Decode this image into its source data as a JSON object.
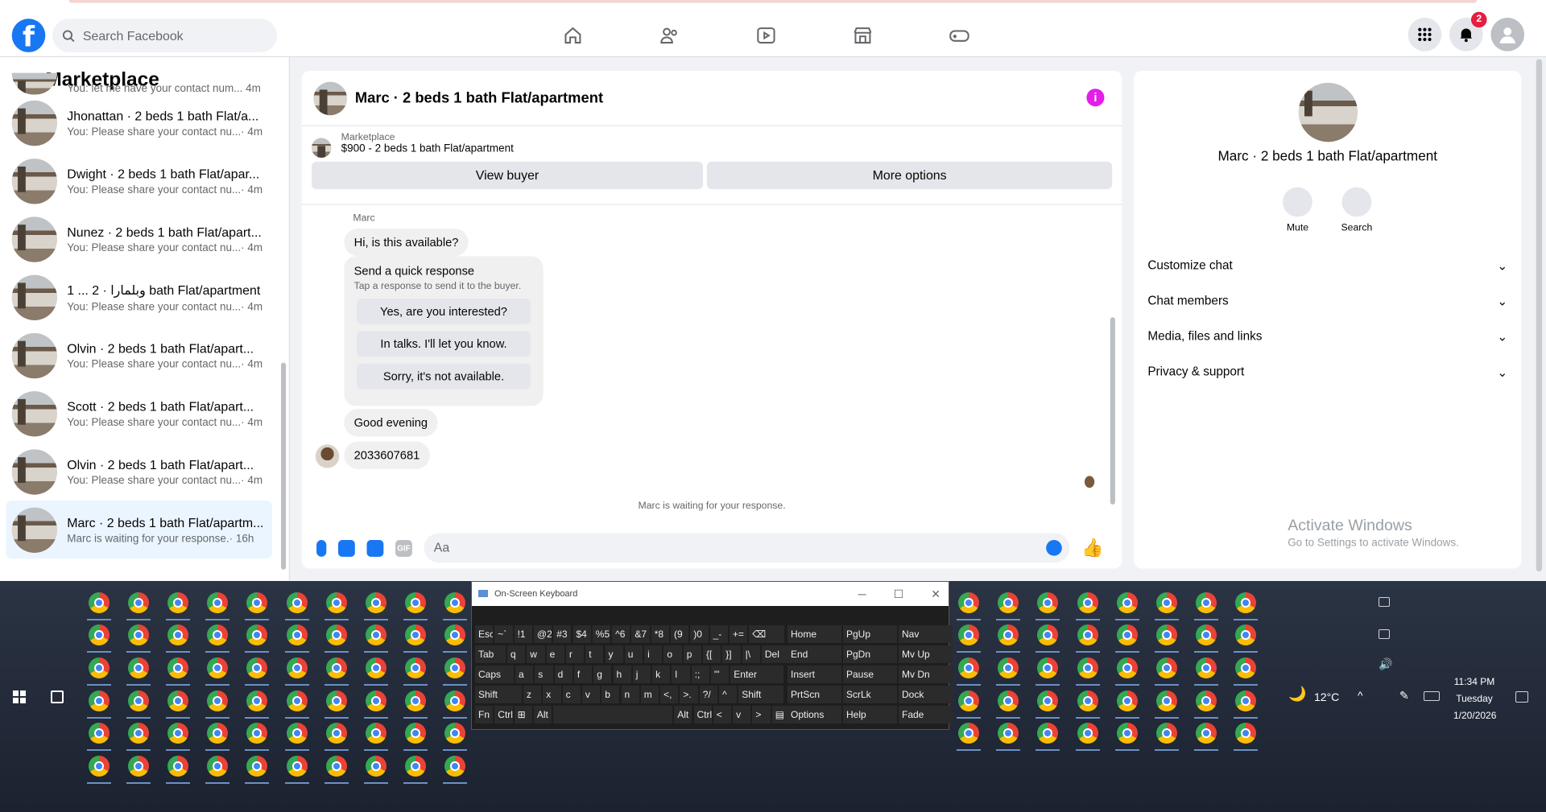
{
  "header": {
    "search_placeholder": "Search Facebook",
    "notifications_count": "2"
  },
  "marketplace": {
    "title": "Marketplace",
    "partial_top": "You: let me have your contact num...",
    "partial_time": "4m",
    "conversations": [
      {
        "name": "Jhonattan · 2 beds 1 bath Flat/a...",
        "preview": "You: Please share your contact nu...",
        "time": "· 4m"
      },
      {
        "name": "Dwight · 2 beds 1 bath Flat/apar...",
        "preview": "You: Please share your contact nu...",
        "time": "· 4m"
      },
      {
        "name": "Nunez · 2 beds 1 bath Flat/apart...",
        "preview": "You: Please share your contact nu...",
        "time": "· 4m"
      },
      {
        "name": "وبلمارا · 2 ... 1 bath Flat/apartment",
        "preview": "You: Please share your contact nu...",
        "time": "· 4m"
      },
      {
        "name": "Olvin · 2 beds 1 bath Flat/apart...",
        "preview": "You: Please share your contact nu...",
        "time": "· 4m"
      },
      {
        "name": "Scott · 2 beds 1 bath Flat/apart...",
        "preview": "You: Please share your contact nu...",
        "time": "· 4m"
      },
      {
        "name": "Olvin · 2 beds 1 bath Flat/apart...",
        "preview": "You: Please share your contact nu...",
        "time": "· 4m"
      },
      {
        "name": "Marc · 2 beds 1 bath Flat/apartm...",
        "preview": "Marc is waiting for your response.",
        "time": "· 16h"
      }
    ]
  },
  "chat": {
    "title": "Marc · 2 beds 1 bath Flat/apartment",
    "mp_label": "Marketplace",
    "mp_listing": "$900 - 2 beds 1 bath Flat/apartment",
    "view_buyer": "View buyer",
    "more_options": "More options",
    "sender": "Marc",
    "msg1": "Hi, is this available?",
    "quick_title": "Send a quick response",
    "quick_sub": "Tap a response to send it to the buyer.",
    "quick_replies": [
      "Yes, are you interested?",
      "In talks. I'll let you know.",
      "Sorry, it's not available."
    ],
    "msg2": "Good evening",
    "msg3": "2033607681",
    "waiting": "Marc is waiting for your response.",
    "input_placeholder": "Aa",
    "gif": "GIF"
  },
  "details": {
    "title": "Marc · 2 beds 1 bath Flat/apartment",
    "mute": "Mute",
    "search": "Search",
    "sections": [
      "Customize chat",
      "Chat members",
      "Media, files and links",
      "Privacy & support"
    ]
  },
  "watermark": {
    "line1": "Activate Windows",
    "line2": "Go to Settings to activate Windows."
  },
  "osk": {
    "title": "On-Screen Keyboard",
    "rows": [
      [
        "Esc",
        "~`",
        "!1",
        "@2",
        "#3",
        "$4",
        "%5",
        "^6",
        "&7",
        "*8",
        "(9",
        ")0",
        "_-",
        "+=",
        "⌫"
      ],
      [
        "Tab",
        "q",
        "w",
        "e",
        "r",
        "t",
        "y",
        "u",
        "i",
        "o",
        "p",
        "{[",
        "}]",
        "|\\",
        "Del"
      ],
      [
        "Caps",
        "a",
        "s",
        "d",
        "f",
        "g",
        "h",
        "j",
        "k",
        "l",
        ":;",
        "\"'",
        "Enter"
      ],
      [
        "Shift",
        "z",
        "x",
        "c",
        "v",
        "b",
        "n",
        "m",
        "<,",
        ">.",
        "?/",
        "^",
        "Shift"
      ],
      [
        "Fn",
        "Ctrl",
        "⊞",
        "Alt",
        "",
        "Alt",
        "Ctrl",
        "<",
        "v",
        ">",
        "▤"
      ]
    ],
    "nav": [
      [
        "Home",
        "PgUp",
        "Nav"
      ],
      [
        "End",
        "PgDn",
        "Mv Up"
      ],
      [
        "Insert",
        "Pause",
        "Mv Dn"
      ],
      [
        "PrtScn",
        "ScrLk",
        "Dock"
      ],
      [
        "Options",
        "Help",
        "Fade"
      ]
    ]
  },
  "tray": {
    "weather": "12°C",
    "time": "11:34 PM",
    "day": "Tuesday",
    "date": "1/20/2026"
  }
}
